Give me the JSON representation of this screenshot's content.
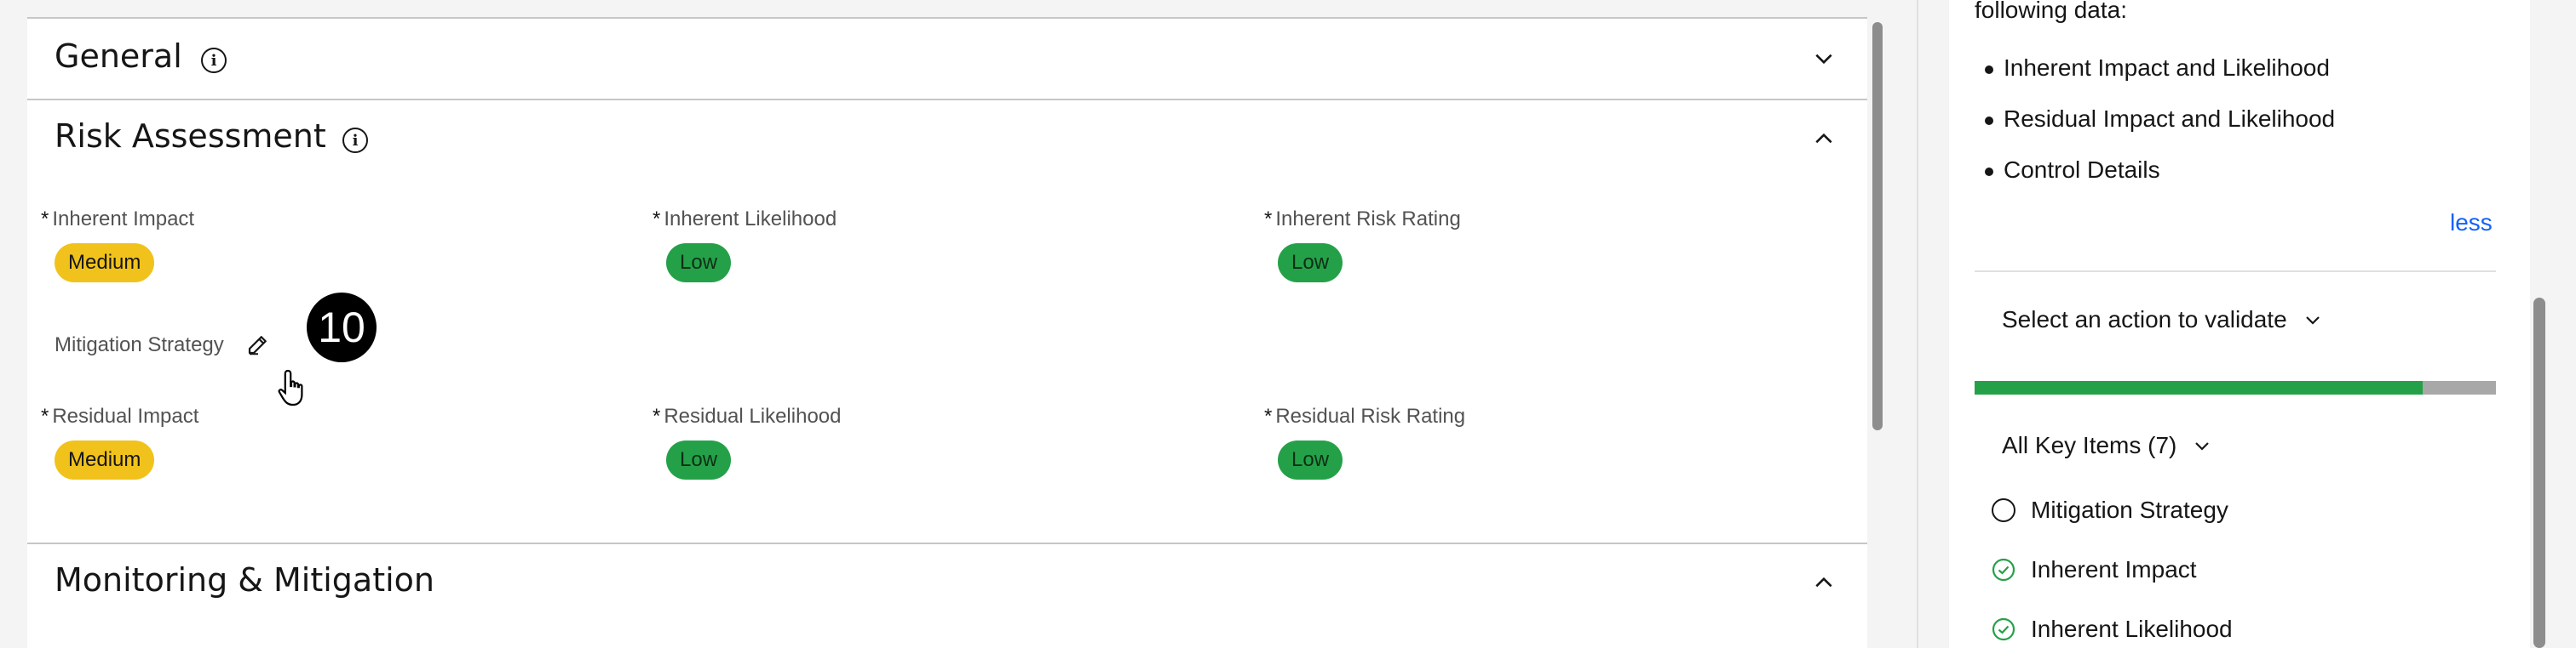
{
  "sections": {
    "general": {
      "title": "General"
    },
    "risk": {
      "title": "Risk Assessment"
    },
    "monitoring": {
      "title": "Monitoring & Mitigation"
    }
  },
  "fields": {
    "required_marker": "*",
    "inherent_impact": {
      "label": "Inherent Impact",
      "value": "Medium"
    },
    "inherent_likelihood": {
      "label": "Inherent Likelihood",
      "value": "Low"
    },
    "inherent_risk_rating": {
      "label": "Inherent Risk Rating",
      "value": "Low"
    },
    "mitigation_strategy": {
      "label": "Mitigation Strategy"
    },
    "residual_impact": {
      "label": "Residual Impact",
      "value": "Medium"
    },
    "residual_likelihood": {
      "label": "Residual Likelihood",
      "value": "Low"
    },
    "residual_risk_rating": {
      "label": "Residual Risk Rating",
      "value": "Low"
    }
  },
  "step_badge": "10",
  "right_panel": {
    "intro_text": "following data:",
    "bullets": [
      "Inherent Impact and Likelihood",
      "Residual Impact and Likelihood",
      "Control Details"
    ],
    "less_link": "less",
    "action_dropdown": "Select an action to validate",
    "progress_fraction": 0.86,
    "key_items_dropdown": "All Key Items (7)",
    "key_items": [
      {
        "label": "Mitigation Strategy",
        "status": "incomplete"
      },
      {
        "label": "Inherent Impact",
        "status": "complete"
      },
      {
        "label": "Inherent Likelihood",
        "status": "complete"
      }
    ]
  },
  "colors": {
    "medium_tag": "#f1c21b",
    "low_tag": "#24a148",
    "link": "#0f62fe",
    "progress_fill": "#24a148",
    "progress_bg": "#a8a8a8"
  }
}
